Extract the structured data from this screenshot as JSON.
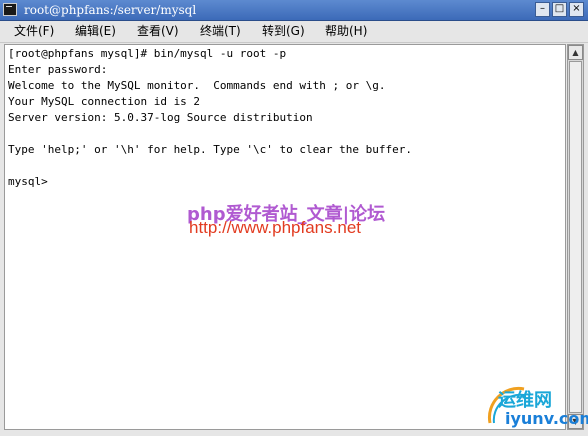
{
  "window": {
    "title": "root@phpfans:/server/mysql",
    "buttons": {
      "minimize": "–",
      "maximize": "□",
      "close": "×"
    }
  },
  "menu": [
    {
      "label": "文件(F)"
    },
    {
      "label": "编辑(E)"
    },
    {
      "label": "查看(V)"
    },
    {
      "label": "终端(T)"
    },
    {
      "label": "转到(G)"
    },
    {
      "label": "帮助(H)"
    }
  ],
  "terminal": {
    "lines": [
      "[root@phpfans mysql]# bin/mysql -u root -p",
      "Enter password:",
      "Welcome to the MySQL monitor.  Commands end with ; or \\g.",
      "Your MySQL connection id is 2",
      "Server version: 5.0.37-log Source distribution",
      "",
      "Type 'help;' or '\\h' for help. Type '\\c' to clear the buffer.",
      "",
      "mysql>"
    ]
  },
  "watermark": {
    "site_name": "php爱好者站_文章|论坛",
    "site_url": "http://www.phpfans.net",
    "brand_cn": "运维网",
    "brand_domain": "iyunv.com"
  },
  "colors": {
    "titlebar": "#3c6ab8",
    "terminal_bg": "#ffffff",
    "watermark_purple": "#a33ec9",
    "watermark_red": "#e23b20",
    "watermark_blue": "#1aa7d8"
  }
}
